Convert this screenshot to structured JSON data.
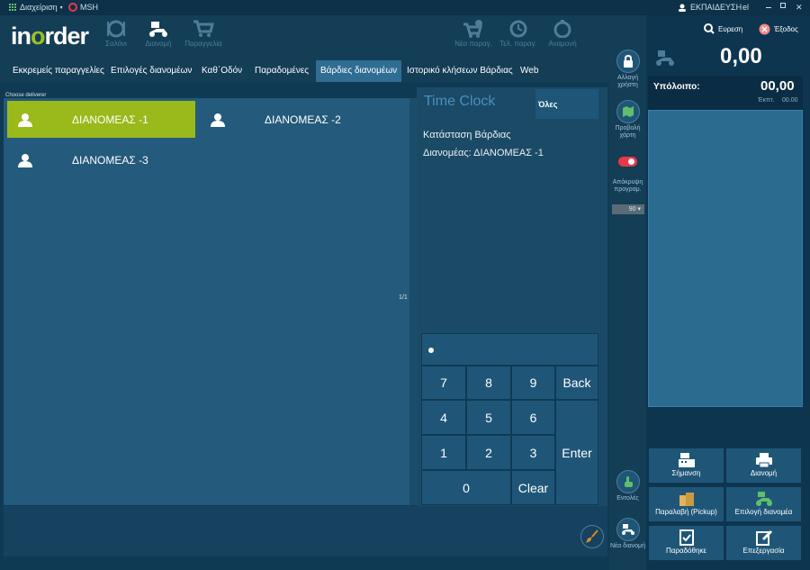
{
  "sysbar": {
    "admin_menu": "Διαχείριση",
    "user_short": "MSH",
    "training": "ΕΚΠΑΙΔΕΥΣΗ",
    "lang": "el",
    "colors": {
      "bg": "#0c3148",
      "accent_green": "#9ab91b"
    }
  },
  "header": {
    "logo_in": "in",
    "logo_o": "o",
    "logo_rder": "rder",
    "nav": [
      {
        "label": "Σαλόνι",
        "icon": "dining-plate-icon"
      },
      {
        "label": "Διανομή",
        "icon": "delivery-scooter-icon"
      },
      {
        "label": "Παραγγελία",
        "icon": "cart-icon"
      }
    ],
    "actions": [
      {
        "label": "Νέα παραγ.",
        "icon": "cart-add-icon"
      },
      {
        "label": "Τελ. παραγ.",
        "icon": "history-icon"
      },
      {
        "label": "Αναμονή",
        "icon": "timer-icon"
      }
    ]
  },
  "tabs": [
    "Εκκρεμείς παραγγελίες",
    "Επιλογές διανομέων",
    "Καθ΄Οδόν",
    "Παραδομένες",
    "Βάρδιες διανομέων",
    "Ιστορικό κλήσεων Βάρδιας",
    "Web"
  ],
  "active_tab": "Βάρδιες διανομέων",
  "deliverers": {
    "heading": "Choose deliverer",
    "items": [
      "ΔΙΑΝΟΜΕΑΣ -1",
      "ΔΙΑΝΟΜΕΑΣ -2",
      "ΔΙΑΝΟΜΕΑΣ -3"
    ],
    "selected": "ΔΙΑΝΟΜΕΑΣ -1",
    "pager": "1/1"
  },
  "timeclock": {
    "title": "Time Clock",
    "filter": "Όλες",
    "status_label": "Κατάσταση Βάρδιας",
    "deliverer_line": "Διανομέας: ΔΙΑΝΟΜΕΑΣ -1"
  },
  "keypad": {
    "keys": [
      "7",
      "8",
      "9",
      "Back",
      "4",
      "5",
      "6",
      "Enter",
      "1",
      "2",
      "3",
      "0",
      "Clear"
    ]
  },
  "side": {
    "change_user": "Αλλαγή χρήστη",
    "view_map": "Προβολή χάρτη",
    "hide_prog": "Απόκρυψη προγραμ.",
    "select_value": "90",
    "commands": "Εντολές",
    "new_delivery": "Νέα διανομή"
  },
  "right": {
    "search": "Ευρεση",
    "exit": "Έξοδος",
    "total": "0,00",
    "balance_label": "Υπόλοιπο:",
    "balance_value": "00,00",
    "discount_label": "Έκπτ.",
    "discount_value": "00.00",
    "actions": [
      {
        "label": "Σήμανση",
        "icon": "cash-register-icon"
      },
      {
        "label": "Διανομή",
        "icon": "printer-icon"
      },
      {
        "label": "Παραλαβή (Pickup)",
        "icon": "pickup-bag-icon"
      },
      {
        "label": "Επιλογή διανομέα",
        "icon": "delivery-scooter-icon"
      },
      {
        "label": "Παραδόθηκε",
        "icon": "delivered-check-icon"
      },
      {
        "label": "Επεξεργασία",
        "icon": "edit-pencil-icon"
      }
    ]
  }
}
